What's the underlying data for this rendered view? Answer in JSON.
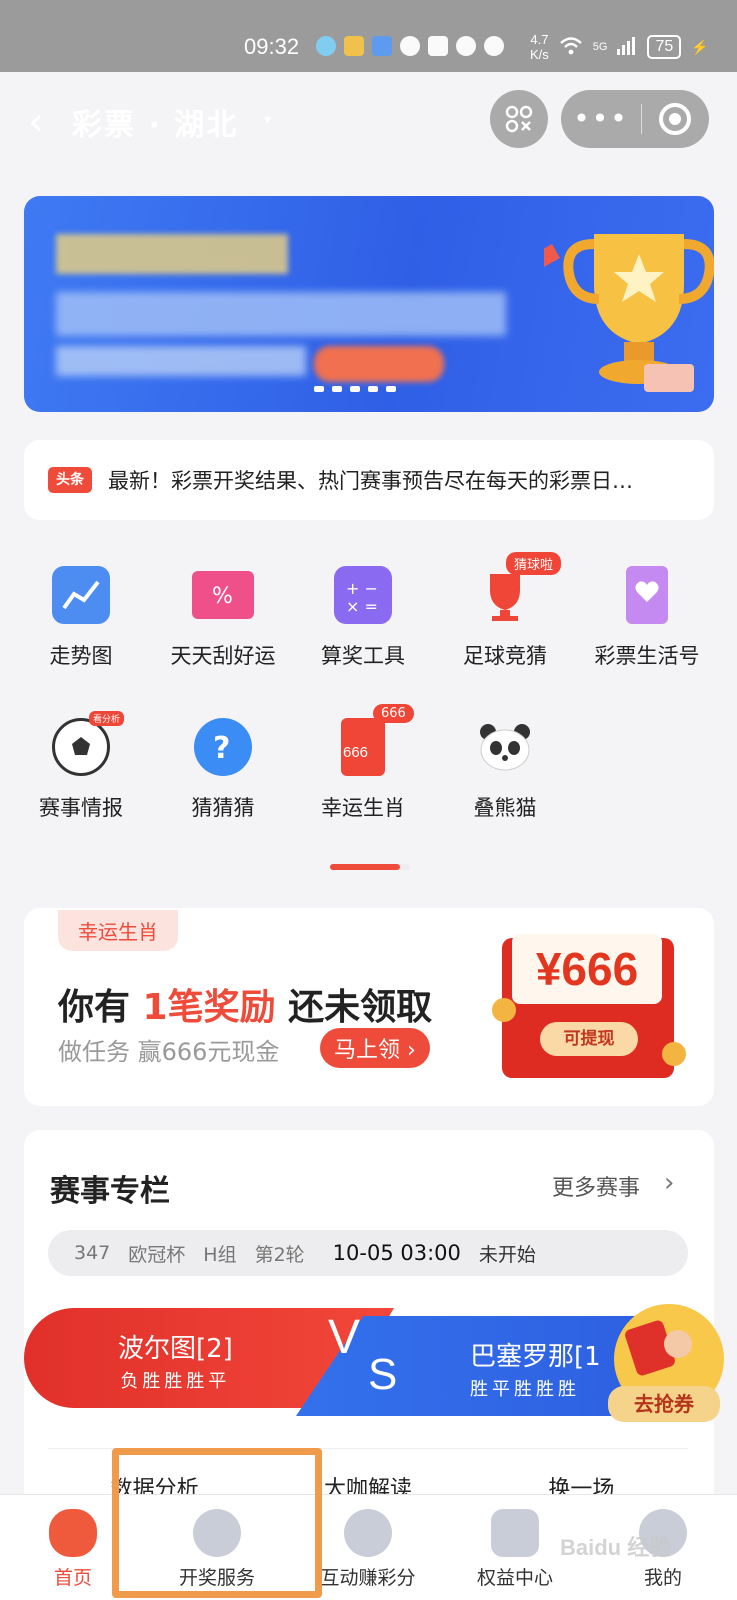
{
  "status_bar": {
    "time": "09:32",
    "speed_value": "4.7",
    "speed_unit": "K/s",
    "network": "5G",
    "battery": "75"
  },
  "nav": {
    "title": "彩票 · 湖北",
    "caret": "▾",
    "more": "•••",
    "back": "‹"
  },
  "headline": {
    "badge": "头条",
    "text": "最新！彩票开奖结果、热门赛事预告尽在每天的彩票日…"
  },
  "grid": {
    "items": [
      {
        "label": "走势图",
        "icon": "trend-chart-icon",
        "color": "#4d8df2"
      },
      {
        "label": "天天刮好运",
        "icon": "scratch-ticket-icon",
        "color": "#f0508a"
      },
      {
        "label": "算奖工具",
        "icon": "calculator-icon",
        "color": "#8a6af0"
      },
      {
        "label": "足球竞猜",
        "icon": "trophy-icon",
        "color": "#ef4637",
        "tag": "猜球啦"
      },
      {
        "label": "彩票生活号",
        "icon": "heart-bookmark-icon",
        "color": "#c58af2"
      },
      {
        "label": "赛事情报",
        "icon": "soccer-ball-icon",
        "color": "#333333",
        "tag": "看分析"
      },
      {
        "label": "猜猜猜",
        "icon": "question-bubble-icon",
        "color": "#3c8cf5"
      },
      {
        "label": "幸运生肖",
        "icon": "lucky-card-icon",
        "color": "#ef4637",
        "tag": "666"
      },
      {
        "label": "叠熊猫",
        "icon": "panda-icon",
        "color": "#555555"
      }
    ],
    "lucky_card_text": "666"
  },
  "reward": {
    "tag": "幸运生肖",
    "title_pre": "你有 ",
    "title_highlight": "1笔奖励",
    "title_post": " 还未领取",
    "subtitle": "做任务 赢666元现金",
    "claim_button": "马上领 ›",
    "envelope_amount": "¥666",
    "envelope_button": "可提现"
  },
  "match": {
    "title": "赛事专栏",
    "more_label": "更多赛事",
    "more_icon": "›",
    "info": {
      "number": "347",
      "league": "欧冠杯",
      "group": "H组",
      "round": "第2轮",
      "time": "10-05 03:00",
      "state": "未开始"
    },
    "home_team": {
      "name": "波尔图[2]",
      "form": "负胜胜胜平"
    },
    "away_team": {
      "name": "巴塞罗那[1",
      "form": "胜平胜胜胜"
    },
    "vs_v": "V",
    "vs_s": "S",
    "coupon_label": "去抢券",
    "tabs": [
      "数据分析",
      "大咖解读",
      "换一场"
    ]
  },
  "tabbar": {
    "items": [
      {
        "label": "首页",
        "icon": "home-mascot-icon",
        "active": true
      },
      {
        "label": "开奖服务",
        "icon": "crystal-ball-icon",
        "active": false
      },
      {
        "label": "互动赚彩分",
        "icon": "planet-icon",
        "active": false
      },
      {
        "label": "权益中心",
        "icon": "clover-gem-icon",
        "active": false
      },
      {
        "label": "我的",
        "icon": "profile-icon",
        "active": false
      }
    ]
  },
  "watermark": "Baidu 经验",
  "colors": {
    "accent": "#ee4b3a",
    "blue": "#3471ec",
    "highlight_box": "#f09a4c"
  }
}
